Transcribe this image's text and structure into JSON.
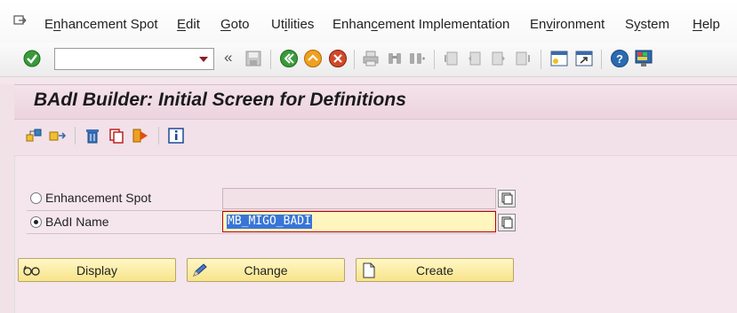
{
  "menubar": {
    "items": [
      {
        "prefix": "E",
        "accel": "n",
        "rest": "hancement Spot"
      },
      {
        "prefix": "",
        "accel": "E",
        "rest": "dit"
      },
      {
        "prefix": "",
        "accel": "G",
        "rest": "oto"
      },
      {
        "prefix": "Ut",
        "accel": "i",
        "rest": "lities"
      },
      {
        "prefix": "Enhan",
        "accel": "c",
        "rest": "ement Implementation"
      },
      {
        "prefix": "En",
        "accel": "v",
        "rest": "ironment"
      },
      {
        "prefix": "S",
        "accel": "y",
        "rest": "stem"
      },
      {
        "prefix": "",
        "accel": "H",
        "rest": "elp"
      }
    ]
  },
  "toolbar": {
    "command_field_value": "",
    "collapse_glyph": "«"
  },
  "screen": {
    "title": "BAdI Builder: Initial Screen for Definitions"
  },
  "form": {
    "options": [
      {
        "label": "Enhancement Spot",
        "selected": false,
        "value": ""
      },
      {
        "label": "BAdI Name",
        "selected": true,
        "value": "MB_MIGO_BADI"
      }
    ]
  },
  "buttons": {
    "display": "Display",
    "change": "Change",
    "create": "Create"
  },
  "colors": {
    "background": "#f4e6ec",
    "button_fill": "#f8e48a",
    "selection": "#3875d7",
    "ok_green": "#2a8a2a"
  }
}
